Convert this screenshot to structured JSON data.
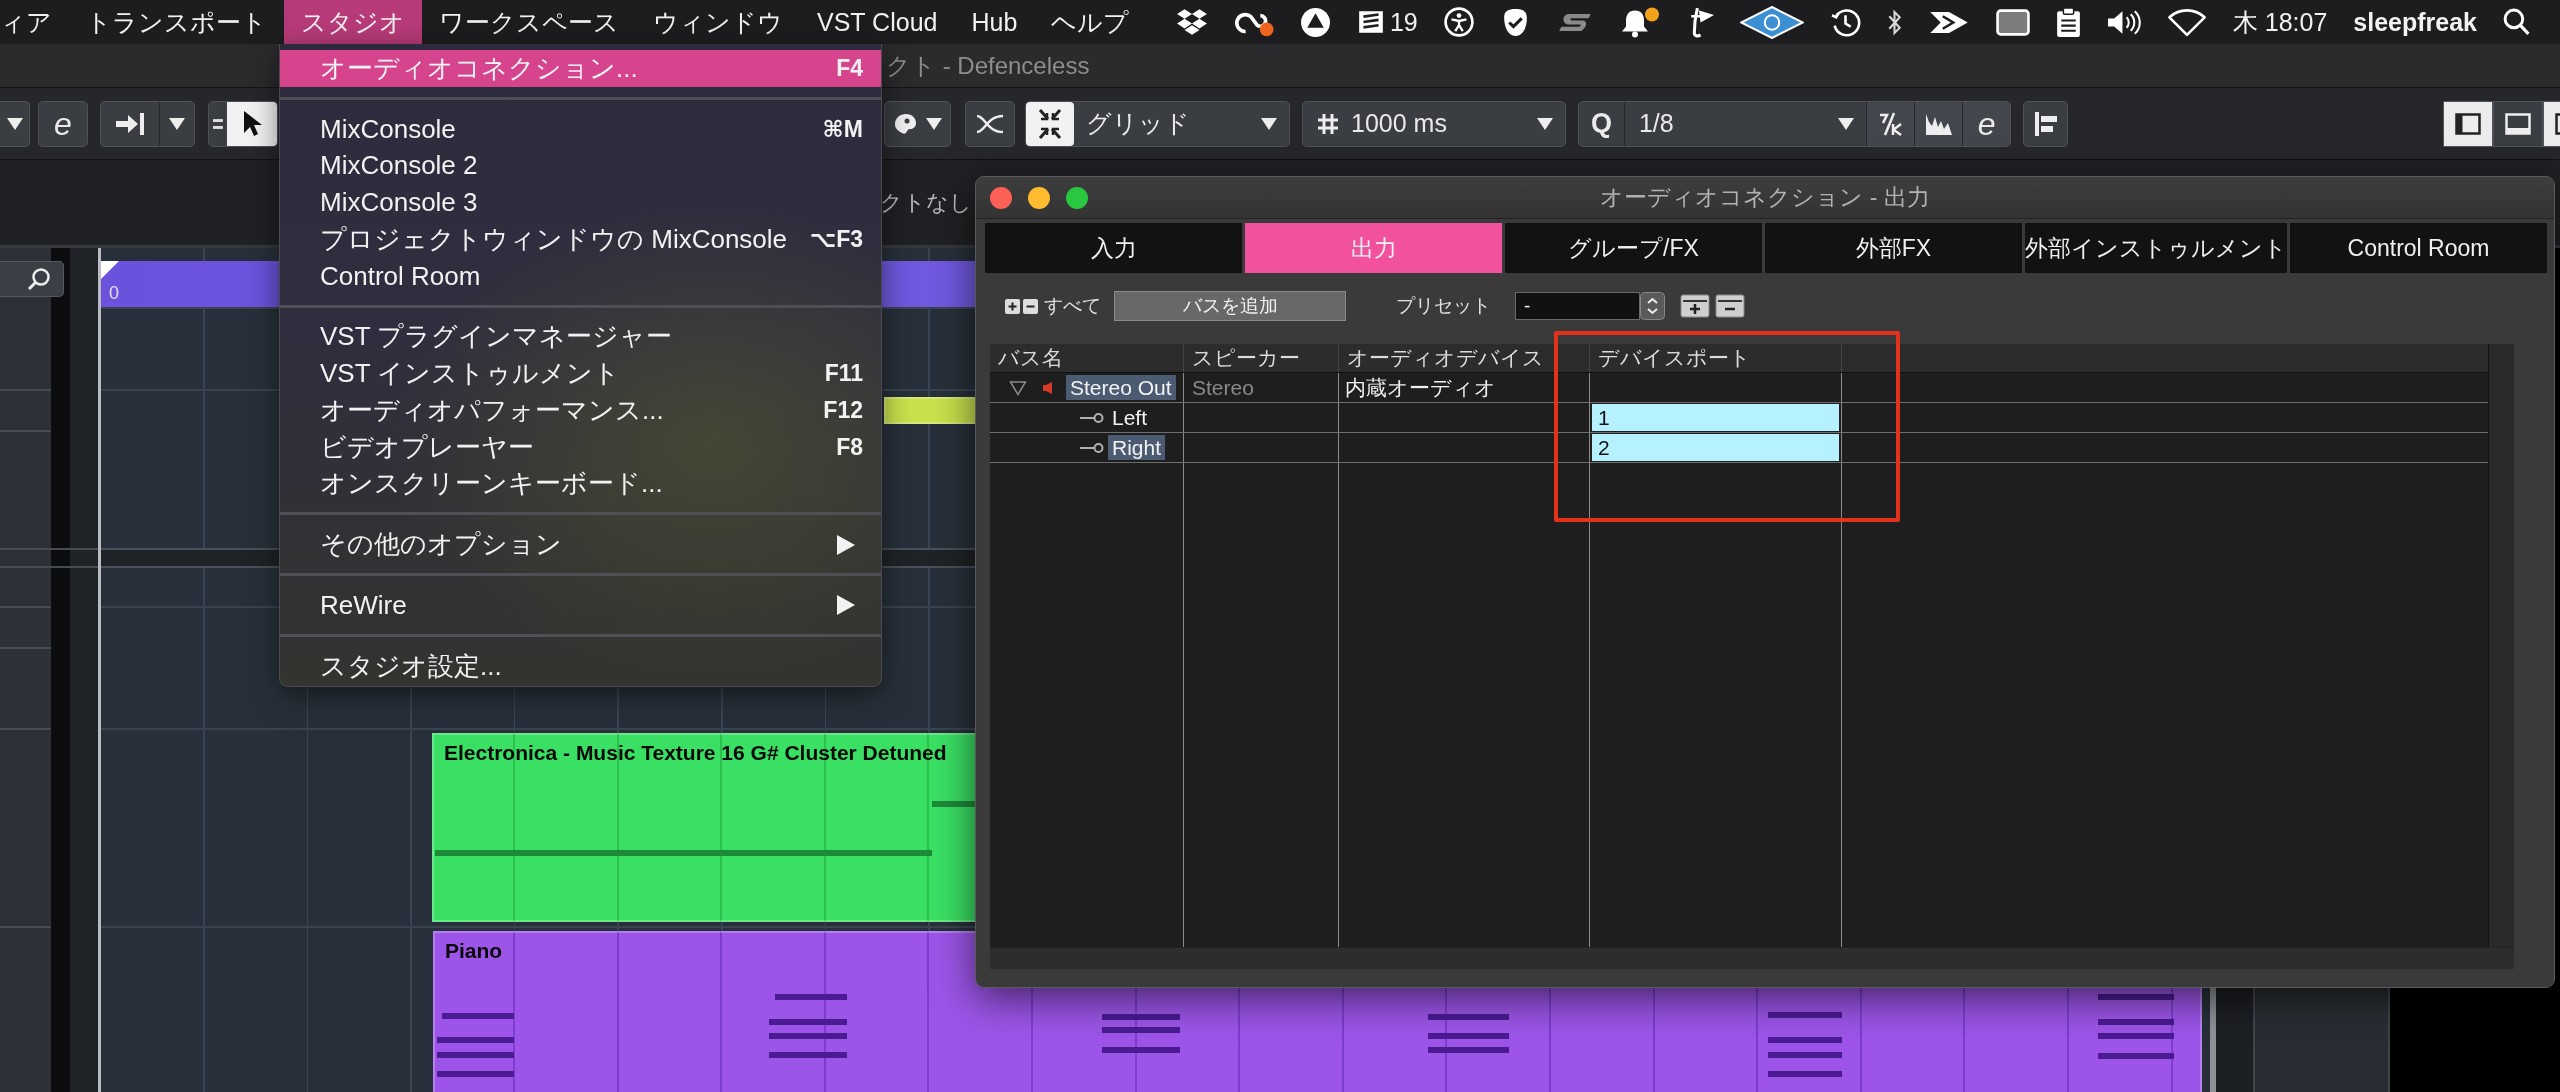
{
  "menu_bar": {
    "items": [
      {
        "label": "ィア",
        "selected": false
      },
      {
        "label": "トランスポート",
        "selected": false
      },
      {
        "label": "スタジオ",
        "selected": true
      },
      {
        "label": "ワークスペース",
        "selected": false
      },
      {
        "label": "ウィンドウ",
        "selected": false
      },
      {
        "label": "VST Cloud",
        "selected": false
      },
      {
        "label": "Hub",
        "selected": false
      },
      {
        "label": "ヘルプ",
        "selected": false
      }
    ],
    "notification_count": "19",
    "clock": "木 18:07",
    "user": "sleepfreak"
  },
  "project_window": {
    "title": "クト - Defenceless",
    "toolbar": {
      "left_edit_symbol": "e",
      "snap_type": "グリッド",
      "grid_value": "1000 ms",
      "quantize_symbol": "Q",
      "quantize_value": "1/8",
      "right_edit_symbol": "e"
    },
    "info_line": "クトなし",
    "ruler": {
      "start_label": "0"
    },
    "clips": [
      {
        "kind": "blank",
        "color": "#c9e24c"
      },
      {
        "kind": "audio",
        "name": "Electronica - Music Texture 16 G# Cluster Detuned",
        "color": "#3ae064"
      },
      {
        "kind": "midi",
        "name": "Piano",
        "color": "#9d55e9"
      }
    ]
  },
  "studio_menu": {
    "sections": [
      {
        "items": [
          {
            "label": "オーディオコネクション...",
            "shortcut": "F4",
            "submenu": false,
            "selected": true
          }
        ]
      },
      {
        "items": [
          {
            "label": "MixConsole",
            "shortcut": "⌘M",
            "submenu": false,
            "selected": false
          },
          {
            "label": "MixConsole 2",
            "submenu": false,
            "selected": false
          },
          {
            "label": "MixConsole 3",
            "submenu": false,
            "selected": false
          },
          {
            "label": "プロジェクトウィンドウの MixConsole",
            "shortcut": "⌥F3",
            "submenu": false,
            "selected": false
          },
          {
            "label": "Control Room",
            "submenu": false,
            "selected": false
          }
        ]
      },
      {
        "items": [
          {
            "label": "VST プラグインマネージャー",
            "submenu": false,
            "selected": false
          },
          {
            "label": "VST インストゥルメント",
            "shortcut": "F11",
            "submenu": false,
            "selected": false
          },
          {
            "label": "オーディオパフォーマンス...",
            "shortcut": "F12",
            "submenu": false,
            "selected": false
          },
          {
            "label": "ビデオプレーヤー",
            "shortcut": "F8",
            "submenu": false,
            "selected": false
          },
          {
            "label": "オンスクリーンキーボード...",
            "submenu": false,
            "selected": false
          }
        ]
      },
      {
        "items": [
          {
            "label": "その他のオプション",
            "submenu": true,
            "selected": false
          }
        ]
      },
      {
        "items": [
          {
            "label": "ReWire",
            "submenu": true,
            "selected": false
          }
        ]
      },
      {
        "items": [
          {
            "label": "スタジオ設定...",
            "submenu": false,
            "selected": false
          }
        ]
      }
    ]
  },
  "audio_connections_dialog": {
    "title": "オーディオコネクション - 出力",
    "tabs": [
      {
        "label": "入力",
        "selected": false
      },
      {
        "label": "出力",
        "selected": true
      },
      {
        "label": "グループ/FX",
        "selected": false
      },
      {
        "label": "外部FX",
        "selected": false
      },
      {
        "label": "外部インストゥルメント",
        "selected": false
      },
      {
        "label": "Control Room",
        "selected": false
      }
    ],
    "toolbar": {
      "all_label": "すべて",
      "add_bus_button": "バスを追加",
      "preset_label": "プリセット",
      "preset_value": "-"
    },
    "table": {
      "columns": [
        "バス名",
        "スピーカー",
        "オーディオデバイス",
        "デバイスポート"
      ],
      "rows": [
        {
          "name": "Stereo Out",
          "expanded": true,
          "selected": true,
          "speaker": "Stereo",
          "audio_device": "内蔵オーディオ",
          "children": [
            {
              "name": "Left",
              "selected": false,
              "device_port": "1"
            },
            {
              "name": "Right",
              "selected": true,
              "device_port": "2"
            }
          ]
        }
      ]
    }
  }
}
